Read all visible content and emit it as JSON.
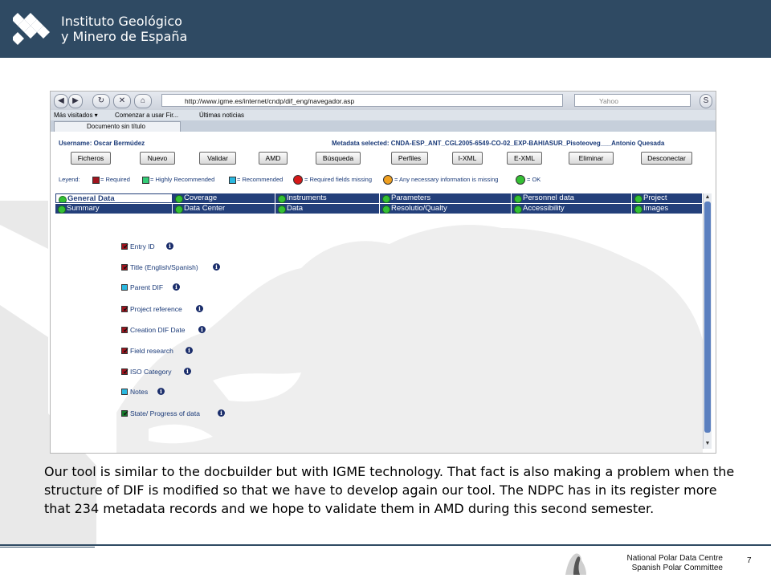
{
  "header": {
    "org_line1": "Instituto Geológico",
    "org_line2": "y Minero de España"
  },
  "browser": {
    "url": "http://www.igme.es/internet/cndp/dif_eng/navegador.asp",
    "search_placeholder": "Yahoo",
    "bookmarks": [
      "Más visitados ▾",
      "Comenzar a usar Fir...",
      "Últimas noticias"
    ],
    "tab_title": "Documento sin título"
  },
  "app": {
    "username_label": "Username: Oscar Bermúdez",
    "metadata_label": "Metadata selected: CNDA-ESP_ANT_CGL2005-6549-CO-02_EXP-BAHIASUR_Pisoteoveg___Antonio Quesada",
    "actions": [
      "Ficheros",
      "Nuevo",
      "Validar",
      "AMD",
      "Búsqueda",
      "Perfiles",
      "I-XML",
      "E-XML",
      "Eliminar",
      "Desconectar"
    ],
    "legend": {
      "title": "Leyend:",
      "required": "= Required",
      "highly_recommended": "= Highly Recommended",
      "recommended": "= Recommended",
      "required_missing": "= Required fields missing",
      "any_missing": "= Any necessary information is missing",
      "ok": "= OK",
      "colors": {
        "required": "#a0141e",
        "highly_recommended": "#33cc77",
        "recommended": "#2ab8e0",
        "missing": "#d61818",
        "any_missing": "#f0a020",
        "ok": "#34c034"
      }
    },
    "tabs_row1": [
      "General Data",
      "Coverage",
      "Instruments",
      "Parameters",
      "Personnel data",
      "Project"
    ],
    "tabs_row2": [
      "Summary",
      "Data Center",
      "Data",
      "Resolutio/Qualty",
      "Accessibility",
      "Images"
    ],
    "fields": [
      {
        "label": "Entry ID",
        "kind": "required",
        "checked": true
      },
      {
        "label": "Title (English/Spanish)",
        "kind": "required",
        "checked": true
      },
      {
        "label": "Parent DIF",
        "kind": "recommended",
        "checked": false
      },
      {
        "label": "Project reference",
        "kind": "required",
        "checked": true
      },
      {
        "label": "Creation DIF Date",
        "kind": "required",
        "checked": true
      },
      {
        "label": "Field research",
        "kind": "required",
        "checked": true
      },
      {
        "label": "ISO Category",
        "kind": "required",
        "checked": true
      },
      {
        "label": "Notes",
        "kind": "recommended",
        "checked": false
      },
      {
        "label": "State/ Progress of data",
        "kind": "ok",
        "checked": true
      }
    ]
  },
  "body_text": "Our tool is similar to the docbuilder but with IGME technology. That fact is also making a problem when the structure of DIF is modified so that we have to develop again our tool. The NDPC has in its register more that 234 metadata records and we hope to validate them in AMD during this second semester.",
  "footer": {
    "line1": "National Polar Data Centre",
    "line2": "Spanish Polar Committee",
    "page_number": "7"
  }
}
